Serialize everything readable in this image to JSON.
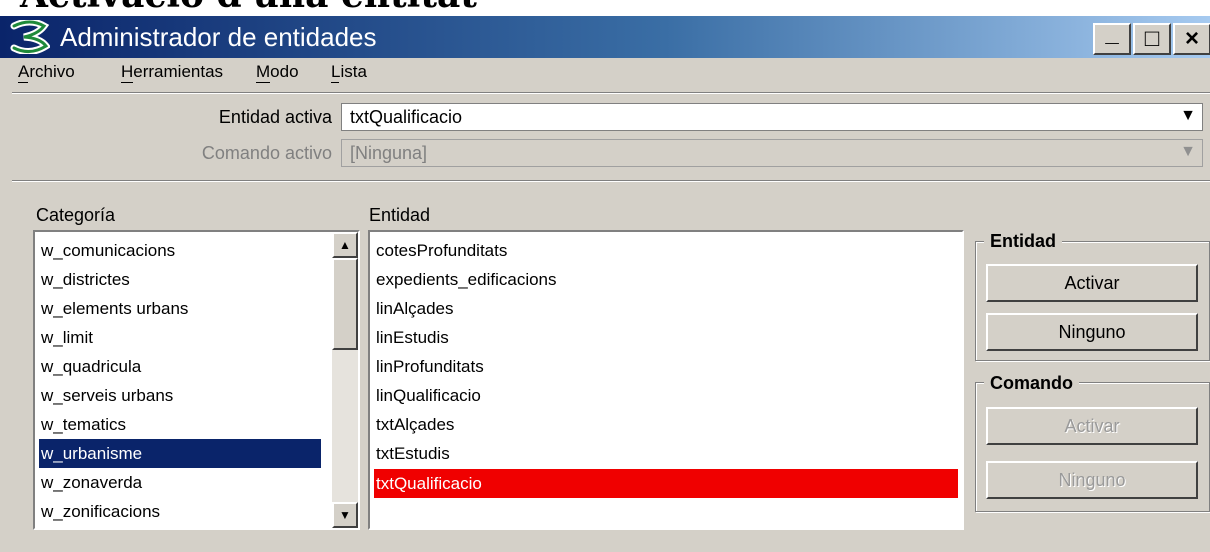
{
  "background_heading": "Activació d'una entitat",
  "window": {
    "title": "Administrador de entidades",
    "min": "_",
    "max": "□",
    "close": "×"
  },
  "menu": [
    "Archivo",
    "Herramientas",
    "Modo",
    "Lista"
  ],
  "entidad_activa": {
    "label": "Entidad activa",
    "value": "txtQualificacio"
  },
  "comando_activo": {
    "label": "Comando activo",
    "value": "[Ninguna]"
  },
  "categoria": {
    "header": "Categoría",
    "items": [
      "w_comunicacions",
      "w_districtes",
      "w_elements urbans",
      "w_limit",
      "w_quadricula",
      "w_serveis urbans",
      "w_tematics",
      "w_urbanisme",
      "w_zonaverda",
      "w_zonificacions"
    ],
    "selected": "w_urbanisme"
  },
  "entidad_list": {
    "header": "Entidad",
    "items": [
      "cotesProfunditats",
      "expedients_edificacions",
      "linAlçades",
      "linEstudis",
      "linProfunditats",
      "linQualificacio",
      "txtAlçades",
      "txtEstudis",
      "txtQualificacio"
    ],
    "selected": "txtQualificacio"
  },
  "entidad_group": {
    "title": "Entidad",
    "activar": "Activar",
    "ninguno": "Ninguno"
  },
  "comando_group": {
    "title": "Comando",
    "activar": "Activar",
    "ninguno": "Ninguno"
  },
  "colors": {
    "title_start": "#0a246a",
    "title_end": "#a6caf0",
    "selected_category": "#0a246a",
    "selected_entity": "#f00000",
    "face": "#d4d0c8"
  }
}
